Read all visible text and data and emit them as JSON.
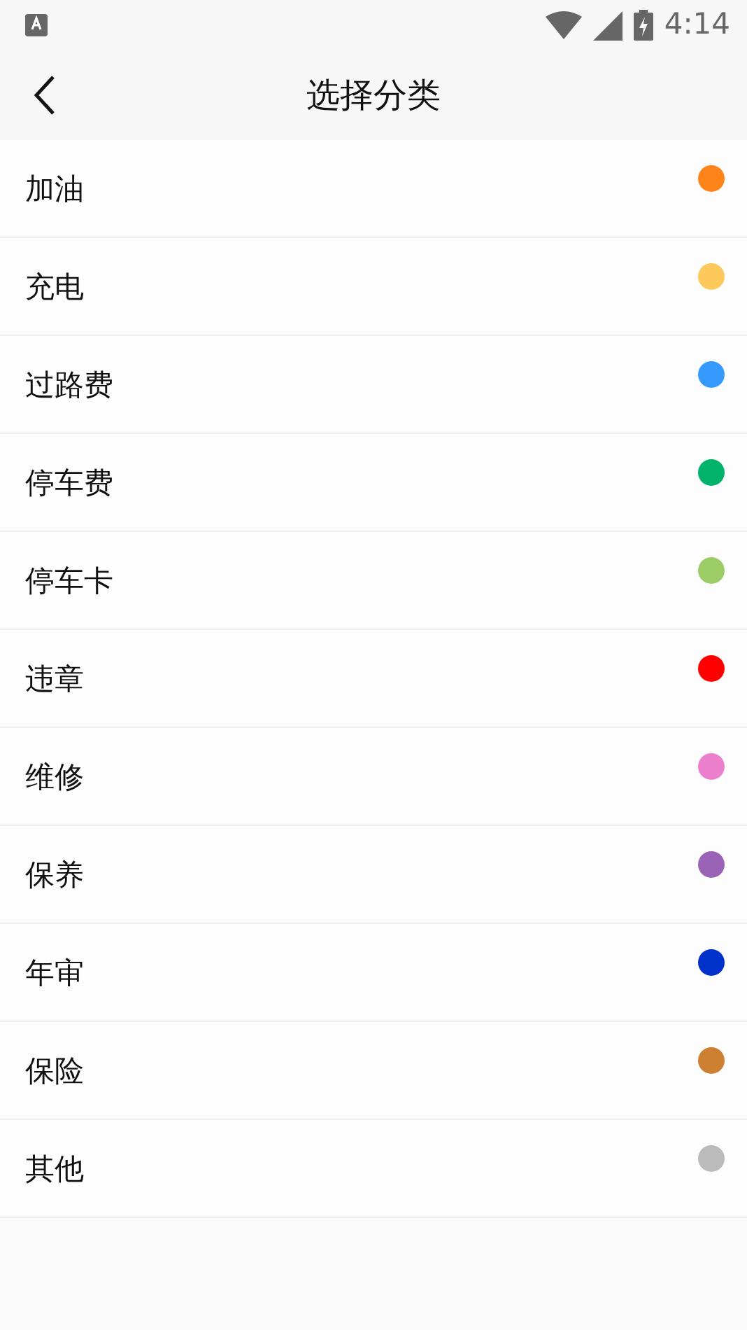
{
  "status_bar": {
    "time": "4:14"
  },
  "header": {
    "title": "选择分类"
  },
  "categories": [
    {
      "label": "加油",
      "color": "#fe8419"
    },
    {
      "label": "充电",
      "color": "#fdc95b"
    },
    {
      "label": "过路费",
      "color": "#3599fd"
    },
    {
      "label": "停车费",
      "color": "#00b26a"
    },
    {
      "label": "停车卡",
      "color": "#9ccc65"
    },
    {
      "label": "违章",
      "color": "#fe0000"
    },
    {
      "label": "维修",
      "color": "#eb7fcb"
    },
    {
      "label": "保养",
      "color": "#9b63b6"
    },
    {
      "label": "年审",
      "color": "#0031cb"
    },
    {
      "label": "保险",
      "color": "#cd7f32"
    },
    {
      "label": "其他",
      "color": "#bbbbbb"
    }
  ]
}
